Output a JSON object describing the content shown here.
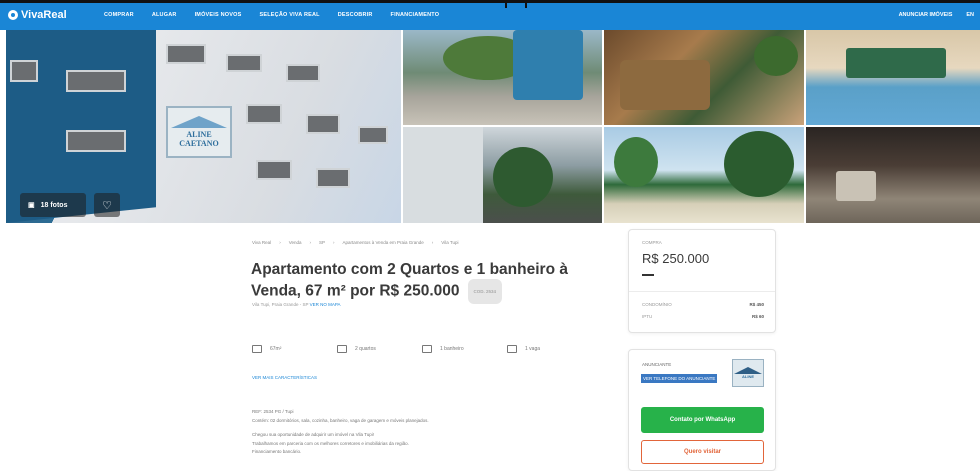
{
  "header": {
    "logo": "VivaReal",
    "nav": [
      "COMPRAR",
      "ALUGAR",
      "IMÓVEIS NOVOS",
      "SELEÇÃO VIVA REAL",
      "DESCOBRIR",
      "FINANCIAMENTO"
    ],
    "right": [
      "ANUNCIAR IMÓVEIS",
      "EN"
    ],
    "color": "#1a86d6"
  },
  "gallery": {
    "sign_line1": "ALINE",
    "sign_line2": "CAETANO",
    "photos_button": "18 fotos"
  },
  "listing": {
    "breadcrumb": [
      "Viva Real",
      "Venda",
      "SP",
      "Apartamentos à Venda em Praia Grande",
      "Vila Tupi"
    ],
    "title": "Apartamento com 2 Quartos e 1 banheiro à Venda, 67 m² por R$ 250.000",
    "code": "COD. 2534",
    "address": "Vila Tupi, Praia Grande - SP",
    "map_link": "VER NO MAPA",
    "features": [
      {
        "icon": "area-icon",
        "label": "67m²"
      },
      {
        "icon": "bed-icon",
        "label": "2 quartos"
      },
      {
        "icon": "bath-icon",
        "label": "1 banheiro"
      },
      {
        "icon": "garage-icon",
        "label": "1 vaga"
      }
    ],
    "more_link": "VER MAIS CARACTERÍSTICAS",
    "description": [
      "REF: 2534 PG / Tupi",
      "Contém: 02 dormitórios, sala, cozinha, banheiro, vaga de garagem e móveis planejados.",
      "Chegou sua oportunidade de adquirir um imóvel na Vila Tupi!",
      "Trabalhamos em parceria com os melhores corretores e imobiliárias da região.",
      "Financiamento bancário."
    ]
  },
  "price_card": {
    "label": "COMPRA",
    "price": "R$ 250.000",
    "rows": [
      {
        "label": "CONDOMÍNIO",
        "value": "R$ 450"
      },
      {
        "label": "IPTU",
        "value": "R$ 60"
      }
    ]
  },
  "contact_card": {
    "agency": "ANUNCIANTE",
    "creci": "VER TELEFONE DO ANUNCIANTE",
    "logo_text": "ALINE",
    "whatsapp_button": "Contato por WhatsApp",
    "message_button": "Quero visitar",
    "whatsapp_color": "#27b24a",
    "message_color": "#e2653a"
  }
}
